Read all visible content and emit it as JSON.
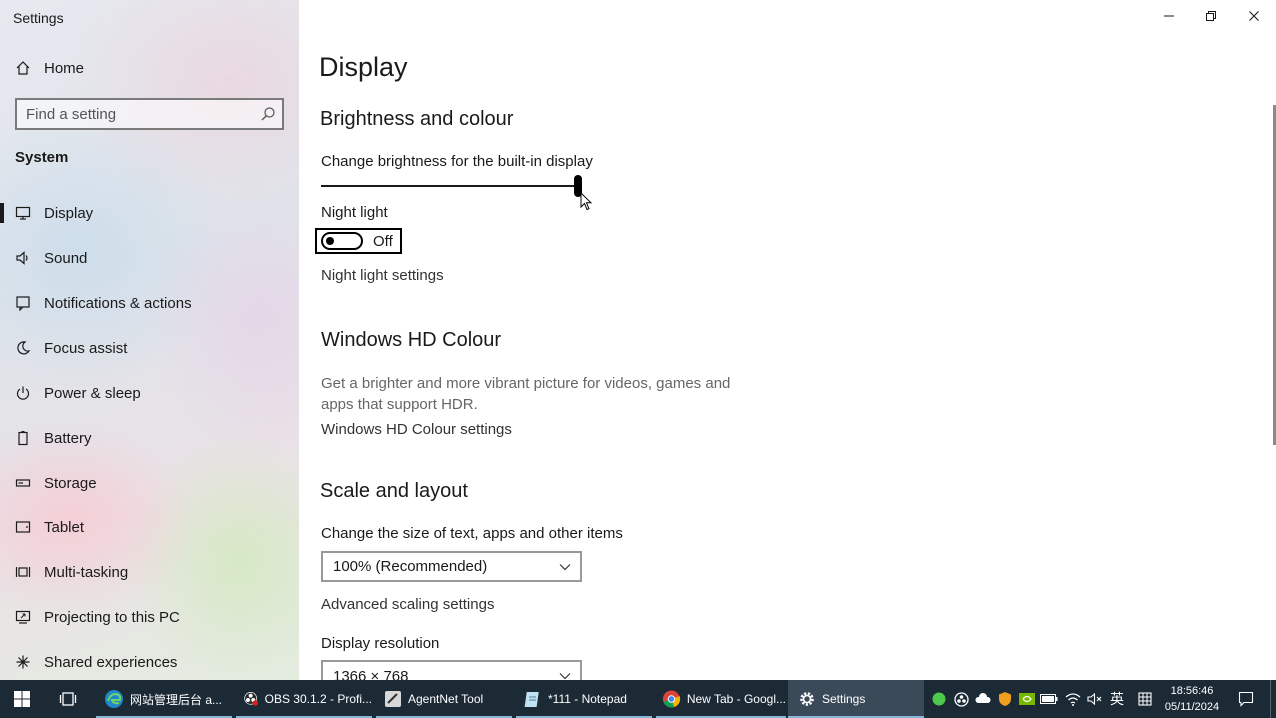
{
  "window": {
    "title": "Settings"
  },
  "sidebar": {
    "home_label": "Home",
    "search_placeholder": "Find a setting",
    "section_label": "System",
    "items": [
      {
        "label": "Display",
        "icon": "monitor-icon",
        "active": true
      },
      {
        "label": "Sound",
        "icon": "speaker-icon"
      },
      {
        "label": "Notifications & actions",
        "icon": "notification-icon"
      },
      {
        "label": "Focus assist",
        "icon": "moon-icon"
      },
      {
        "label": "Power & sleep",
        "icon": "power-icon"
      },
      {
        "label": "Battery",
        "icon": "battery-icon"
      },
      {
        "label": "Storage",
        "icon": "storage-icon"
      },
      {
        "label": "Tablet",
        "icon": "tablet-icon"
      },
      {
        "label": "Multi-tasking",
        "icon": "multitasking-icon"
      },
      {
        "label": "Projecting to this PC",
        "icon": "projecting-icon"
      },
      {
        "label": "Shared experiences",
        "icon": "shared-icon"
      }
    ]
  },
  "main": {
    "page_title": "Display",
    "brightness": {
      "heading": "Brightness and colour",
      "slider_label": "Change brightness for the built-in display",
      "slider_value_percent": 100,
      "night_light_label": "Night light",
      "night_light_state": "Off",
      "night_light_settings_link": "Night light settings"
    },
    "hdr": {
      "heading": "Windows HD Colour",
      "description": "Get a brighter and more vibrant picture for videos, games and apps that support HDR.",
      "settings_link": "Windows HD Colour settings"
    },
    "scale": {
      "heading": "Scale and layout",
      "size_label": "Change the size of text, apps and other items",
      "size_value": "100% (Recommended)",
      "advanced_link": "Advanced scaling settings",
      "resolution_label": "Display resolution",
      "resolution_value": "1366 × 768"
    }
  },
  "taskbar": {
    "apps": [
      {
        "label": "网站管理后台 a...",
        "icon": "edge-icon"
      },
      {
        "label": "OBS 30.1.2 - Profi...",
        "icon": "obs-icon"
      },
      {
        "label": "AgentNet Tool",
        "icon": "agentnet-icon"
      },
      {
        "label": "*111 - Notepad",
        "icon": "notepad-icon"
      },
      {
        "label": "New Tab - Googl...",
        "icon": "chrome-icon"
      },
      {
        "label": "Settings",
        "icon": "gear-icon"
      }
    ],
    "ime_label": "英",
    "time": "18:56:46",
    "date": "05/11/2024"
  },
  "colors": {
    "taskbar_bg": "#1c2a36",
    "accent": "#000000"
  }
}
